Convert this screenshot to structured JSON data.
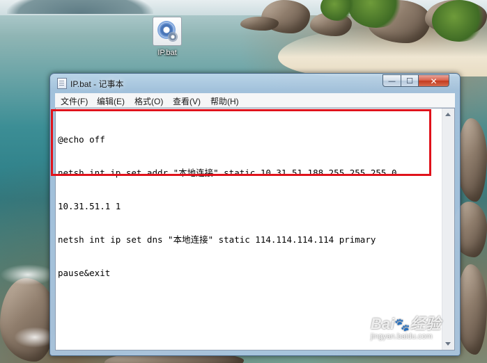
{
  "desktop": {
    "icon_label": "IP.bat"
  },
  "window": {
    "title": "IP.bat - 记事本",
    "controls": {
      "minimize": "—",
      "maximize": "☐",
      "close": "✕"
    }
  },
  "menu": {
    "items": [
      {
        "label": "文件(F)"
      },
      {
        "label": "编辑(E)"
      },
      {
        "label": "格式(O)"
      },
      {
        "label": "查看(V)"
      },
      {
        "label": "帮助(H)"
      }
    ]
  },
  "editor": {
    "lines": [
      "@echo off",
      "netsh int ip set addr \"本地连接\" static 10.31.51.188 255.255.255.0",
      "10.31.51.1 1",
      "netsh int ip set dns \"本地连接\" static 114.114.114.114 primary",
      "pause&exit"
    ]
  },
  "watermark": {
    "brand": "Bai",
    "paw": "🐾",
    "suffix": "经验",
    "url": "jingyan.baidu.com"
  },
  "colors": {
    "highlight_box": "#e0121b"
  }
}
